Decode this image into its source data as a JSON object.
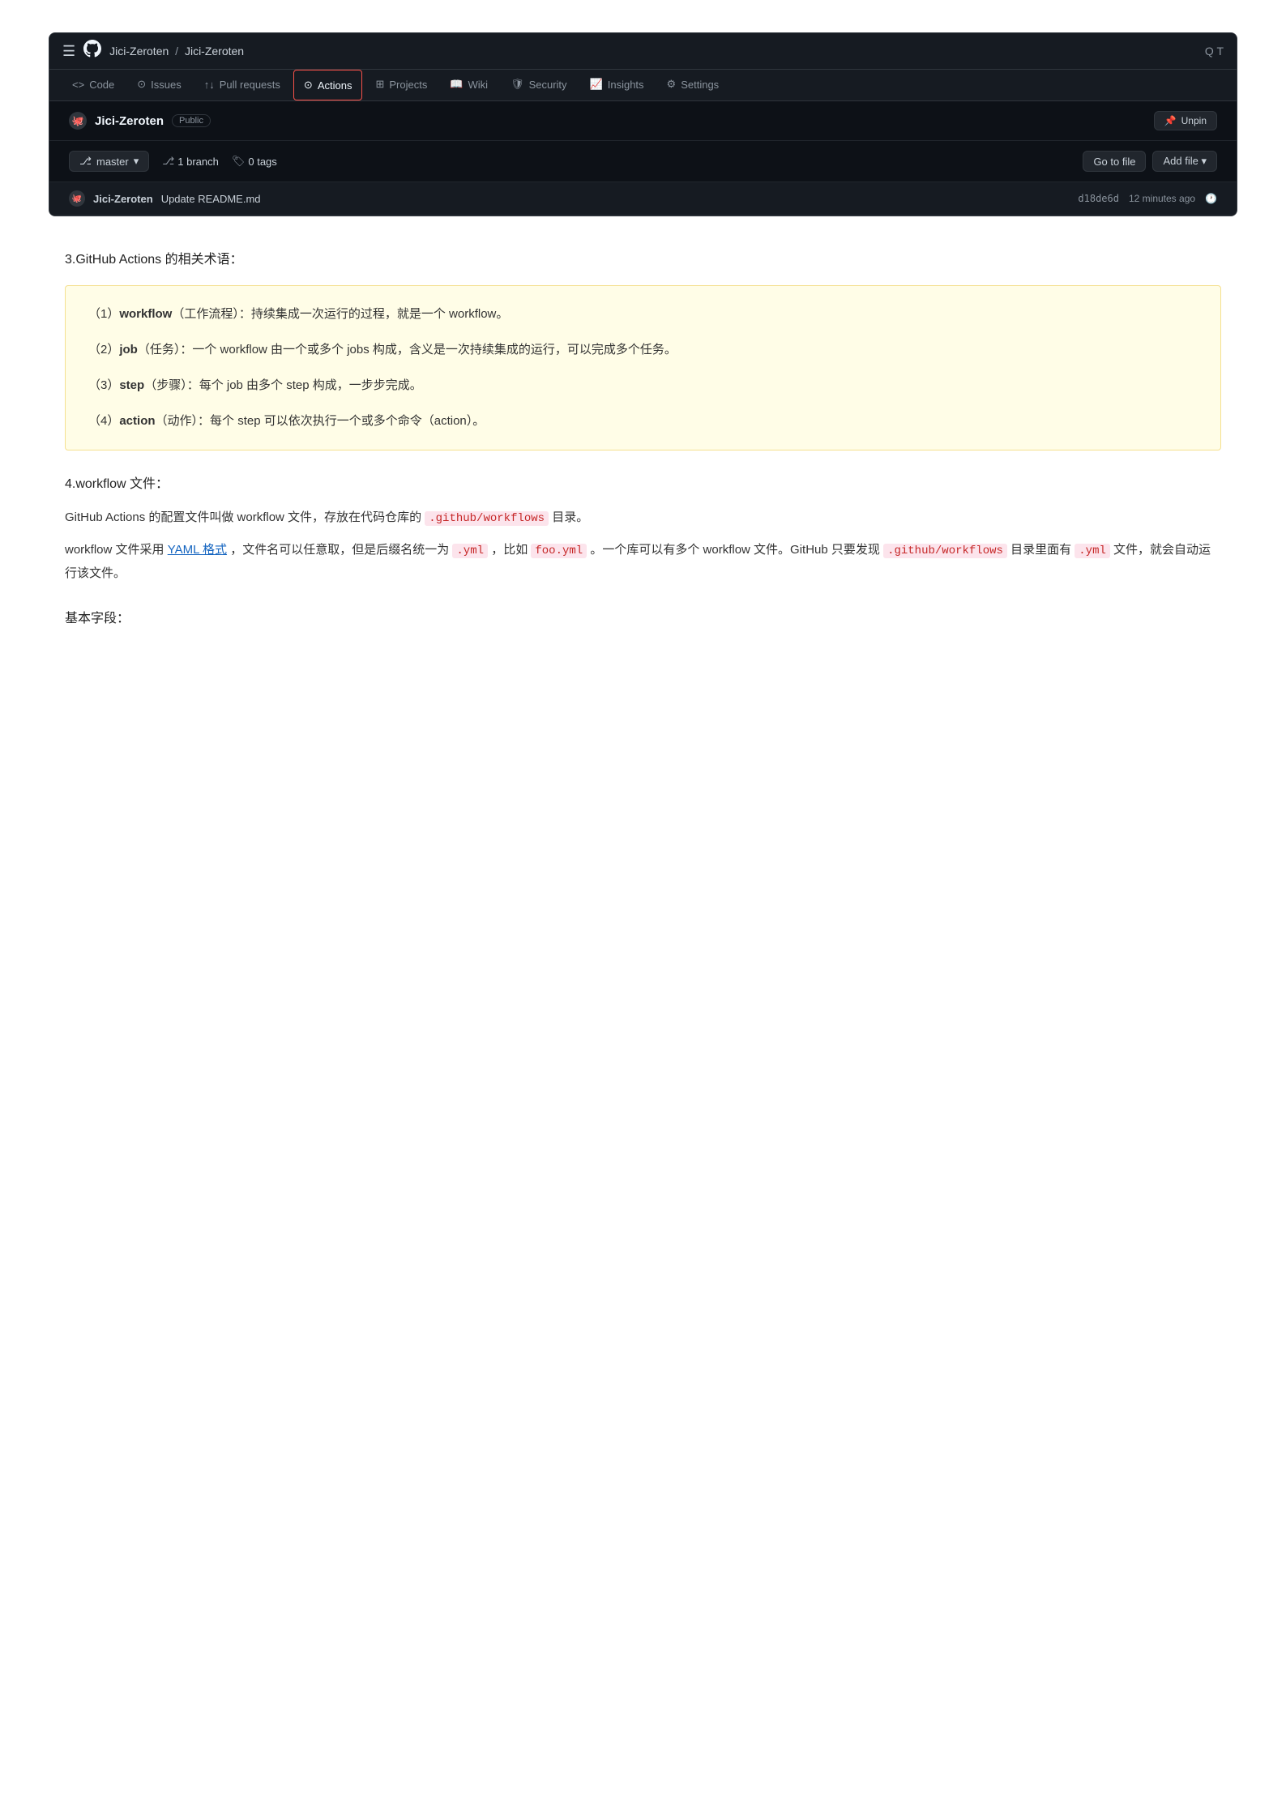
{
  "github": {
    "topbar": {
      "breadcrumb_user": "Jici-Zeroten",
      "breadcrumb_sep": "/",
      "breadcrumb_repo": "Jici-Zeroten",
      "search_label": "Q T"
    },
    "navtabs": [
      {
        "id": "code",
        "icon": "<>",
        "label": "Code",
        "active": false
      },
      {
        "id": "issues",
        "icon": "⊙",
        "label": "Issues",
        "active": false
      },
      {
        "id": "pullrequests",
        "icon": "↑↓",
        "label": "Pull requests",
        "active": false
      },
      {
        "id": "actions",
        "icon": "⊙",
        "label": "Actions",
        "active": false,
        "highlighted": true
      },
      {
        "id": "projects",
        "icon": "⊞",
        "label": "Projects",
        "active": false
      },
      {
        "id": "wiki",
        "icon": "📖",
        "label": "Wiki",
        "active": false
      },
      {
        "id": "security",
        "icon": "🛡",
        "label": "Security",
        "active": false
      },
      {
        "id": "insights",
        "icon": "📈",
        "label": "Insights",
        "active": false
      },
      {
        "id": "settings",
        "icon": "⚙",
        "label": "Settings",
        "active": false
      }
    ],
    "repo": {
      "name": "Jici-Zeroten",
      "visibility": "Public",
      "unpin_label": "Unpin"
    },
    "statsbar": {
      "branch_name": "master",
      "branch_count": "1",
      "branch_label": "branch",
      "tag_count": "0",
      "tag_label": "tags",
      "goto_file_label": "Go to file",
      "add_file_label": "Add file"
    },
    "commit": {
      "author": "Jici-Zeroten",
      "message": "Update README.md",
      "hash": "d18de6d",
      "time": "12 minutes ago"
    }
  },
  "content": {
    "section3_heading": "3.GitHub Actions 的相关术语：",
    "note_items": [
      {
        "id": "workflow",
        "prefix": "（1）",
        "term": "workflow",
        "parens": "（工作流程）",
        "desc": "：持续集成一次运行的过程，就是一个 workflow。"
      },
      {
        "id": "job",
        "prefix": "（2）",
        "term": "job",
        "parens": "（任务）",
        "desc": "：一个 workflow 由一个或多个 jobs 构成，含义是一次持续集成的运行，可以完成多个任务。"
      },
      {
        "id": "step",
        "prefix": "（3）",
        "term": "step",
        "parens": "（步骤）",
        "desc": "：每个 job 由多个 step 构成，一步步完成。"
      },
      {
        "id": "action",
        "prefix": "（4）",
        "term": "action",
        "parens": "（动作）",
        "desc": "：每个 step 可以依次执行一个或多个命令（action）。"
      }
    ],
    "section4_heading": "4.workflow 文件：",
    "para1_before": "GitHub Actions 的配置文件叫做 workflow 文件，存放在代码仓库的",
    "para1_code": ".github/workflows",
    "para1_after": "目录。",
    "para2_before": "workflow 文件采用",
    "para2_link": "YAML 格式",
    "para2_mid1": "，文件名可以任意取，但是后缀名统一为",
    "para2_code1": ".yml",
    "para2_mid2": "，比如",
    "para2_code2": "foo.yml",
    "para2_mid3": "。一个库可以有多个 workflow 文件。GitHub 只要发现",
    "para2_code3": ".github/workflows",
    "para2_mid4": "目录里面有",
    "para2_code4": ".yml",
    "para2_end": "文件，就会自动运行该文件。",
    "section5_heading": "基本字段："
  }
}
